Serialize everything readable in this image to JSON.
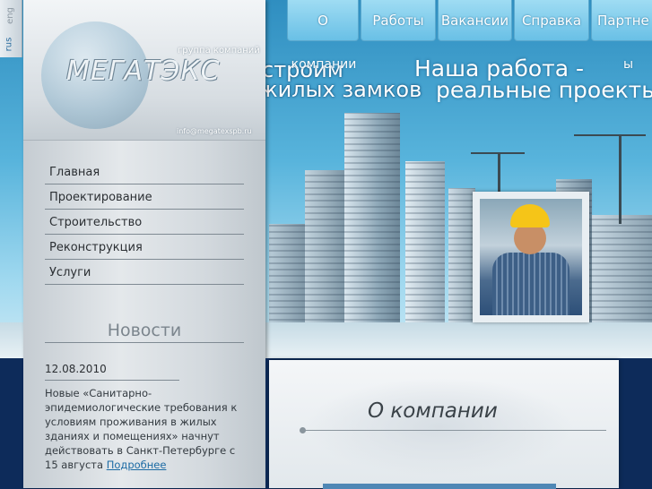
{
  "lang": {
    "rus": "rus",
    "eng": "eng"
  },
  "logo": {
    "text": "МЕГАТЭКС",
    "tagline": "группа компаний",
    "email": "info@megatexspb.ru"
  },
  "nav": [
    {
      "label": "О",
      "overflow": "компании"
    },
    {
      "label": "Работы"
    },
    {
      "label": "Вакансии"
    },
    {
      "label": "Справка"
    },
    {
      "label": "Партне",
      "overflow": "ы"
    }
  ],
  "slogans": {
    "left_line1": "строим",
    "left_line2": "жилых замков",
    "right_line1": "Наша работа -",
    "right_line2": "реальные проекты"
  },
  "menu": [
    "Главная",
    "Проектирование",
    "Строительство",
    "Реконструкция",
    "Услуги"
  ],
  "news": {
    "title": "Новости",
    "date": "12.08.2010",
    "text": "Новые «Санитарно-эпидемиологические требования к условиям проживания в жилых зданиях и помещениях» начнут действовать в Санкт-Петербурге с 15 августа",
    "more": "Подробнее"
  },
  "content": {
    "heading": "О компании"
  },
  "colors": {
    "nav": "#69c0e6",
    "panel": "#d3d9de",
    "link": "#1c6ba4",
    "band": "#0d2b5a"
  }
}
